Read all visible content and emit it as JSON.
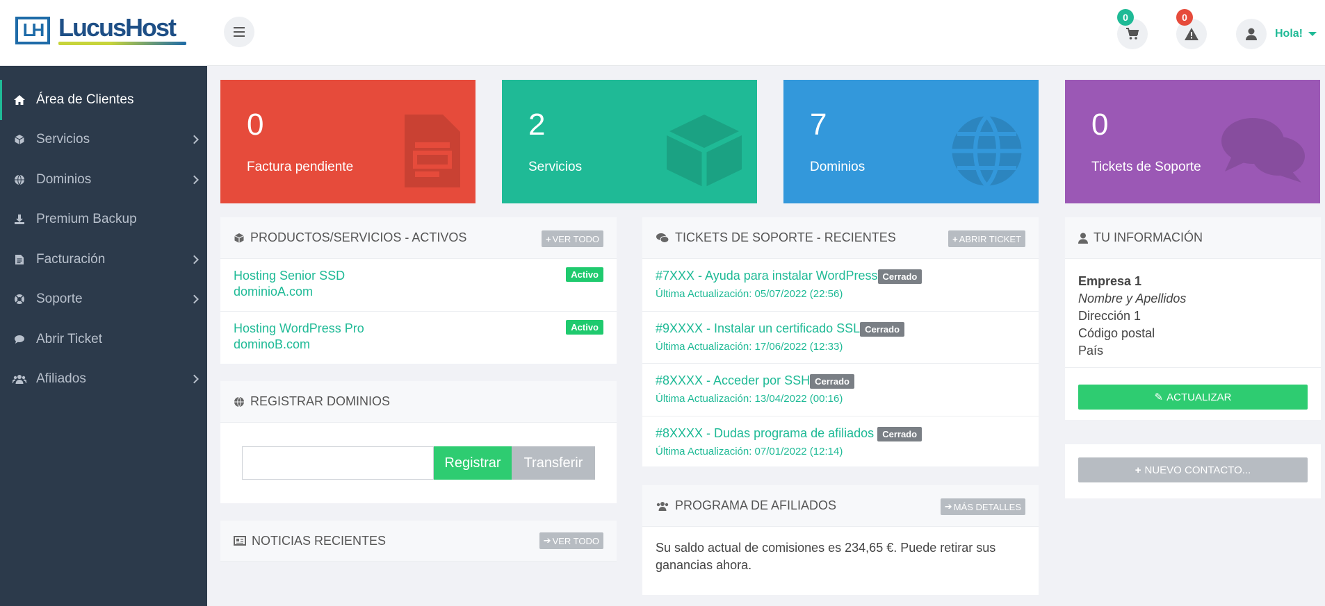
{
  "brand": {
    "name": "LucusHost",
    "mark": "LH"
  },
  "header": {
    "cart_count": "0",
    "alerts_count": "0",
    "user_greeting": "Hola!"
  },
  "sidebar": {
    "items": [
      {
        "label": "Área de Clientes",
        "icon": "home-icon",
        "active": true,
        "has_submenu": false
      },
      {
        "label": "Servicios",
        "icon": "cube-icon",
        "has_submenu": true
      },
      {
        "label": "Dominios",
        "icon": "globe-icon",
        "has_submenu": true
      },
      {
        "label": "Premium Backup",
        "icon": "download-icon",
        "has_submenu": false
      },
      {
        "label": "Facturación",
        "icon": "invoice-icon",
        "has_submenu": true
      },
      {
        "label": "Soporte",
        "icon": "lifebuoy-icon",
        "has_submenu": true
      },
      {
        "label": "Abrir Ticket",
        "icon": "comment-icon",
        "has_submenu": false
      },
      {
        "label": "Afiliados",
        "icon": "users-icon",
        "has_submenu": true
      }
    ]
  },
  "stats": [
    {
      "value": "0",
      "label": "Factura pendiente",
      "color": "#e64b3b",
      "icon": "invoice-icon"
    },
    {
      "value": "2",
      "label": "Servicios",
      "color": "#1fba96",
      "icon": "cube-icon"
    },
    {
      "value": "7",
      "label": "Dominios",
      "color": "#3398db",
      "icon": "globe-icon"
    },
    {
      "value": "0",
      "label": "Tickets de Soporte",
      "color": "#9b58b5",
      "icon": "comments-icon"
    }
  ],
  "products_panel": {
    "title": "PRODUCTOS/SERVICIOS - ACTIVOS",
    "button": "VER TODO",
    "items": [
      {
        "name": "Hosting Senior SSD",
        "domain": "dominioA.com",
        "status": "Activo"
      },
      {
        "name": "Hosting WordPress Pro",
        "domain": "dominoB.com",
        "status": "Activo"
      }
    ]
  },
  "domains_panel": {
    "title": "REGISTRAR DOMINIOS",
    "register_label": "Registrar",
    "transfer_label": "Transferir"
  },
  "news_panel": {
    "title": "NOTICIAS RECIENTES",
    "button": "VER TODO"
  },
  "tickets_panel": {
    "title": "TICKETS DE SOPORTE - RECIENTES",
    "button": "ABRIR TICKET",
    "items": [
      {
        "subject": "#7XXX - Ayuda para instalar WordPress",
        "status": "Cerrado",
        "updated": "Última Actualización: 05/07/2022 (22:56)"
      },
      {
        "subject": "#9XXXX - Instalar un certificado SSL",
        "status": "Cerrado",
        "updated": "Última Actualización: 17/06/2022 (12:33)"
      },
      {
        "subject": "#8XXXX - Acceder por SSH",
        "status": "Cerrado",
        "updated": "Última Actualización: 13/04/2022 (00:16)"
      },
      {
        "subject": "#8XXXX - Dudas programa de afiliados",
        "status": "Cerrado",
        "updated": "Última Actualización: 07/01/2022 (12:14)"
      }
    ]
  },
  "affiliates_panel": {
    "title": "PROGRAMA DE AFILIADOS",
    "button": "MÁS DETALLES",
    "text": "Su saldo actual de comisiones es 234,65 €. Puede retirar sus ganancias ahora."
  },
  "info_panel": {
    "title": "TU INFORMACIÓN",
    "company": "Empresa 1",
    "name": "Nombre y Apellidos",
    "address": "Dirección 1",
    "postal": "Código postal",
    "country": "País",
    "update_button": "ACTUALIZAR"
  },
  "contact_panel": {
    "button": "NUEVO CONTACTO..."
  },
  "colors": {
    "accent": "#1fba96",
    "sidebar": "#2c3a4b",
    "success": "#2ecc71"
  }
}
